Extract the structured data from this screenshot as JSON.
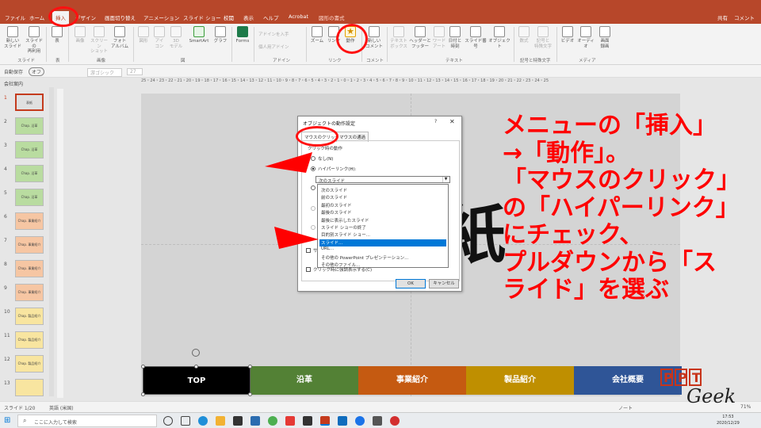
{
  "tabs": [
    {
      "label": "ファイル",
      "active": false
    },
    {
      "label": "ホーム",
      "active": false
    },
    {
      "label": "挿入",
      "active": true
    },
    {
      "label": "デザイン",
      "active": false
    },
    {
      "label": "画面切り替え",
      "active": false
    },
    {
      "label": "アニメーション",
      "active": false
    },
    {
      "label": "スライド ショー",
      "active": false
    },
    {
      "label": "校閲",
      "active": false
    },
    {
      "label": "表示",
      "active": false
    },
    {
      "label": "ヘルプ",
      "active": false
    },
    {
      "label": "Acrobat",
      "active": false
    },
    {
      "label": "図形の書式",
      "active": false
    }
  ],
  "titlebar": {
    "share": "共有",
    "comment": "コメント"
  },
  "ribbon": {
    "buttons": {
      "new_slide": "新しい\nスライド",
      "reuse_slide": "スライドの\n再利用",
      "table": "表",
      "image": "画像",
      "screenshot": "スクリーン\nショット",
      "photo_album": "フォト\nアルバム",
      "shapes": "図形",
      "icons": "アイ\nコン",
      "models_3d": "3D\nモデル",
      "smartart": "SmartArt",
      "chart": "グラフ",
      "forms": "Forms",
      "addins_get": "アドインを入手",
      "addins_personal": "個人用アドイン",
      "zoom": "ズーム",
      "link": "リンク",
      "action": "動作",
      "new_comment": "新しい\nコメント",
      "textbox": "テキスト\nボックス",
      "header_footer": "ヘッダーと\nフッター",
      "wordart": "ワード\nアート",
      "date_time": "日付と\n時刻",
      "slide_number": "スライド番号",
      "object": "オブジェクト",
      "equation": "数式",
      "symbol": "記号と\n特殊文字",
      "video": "ビデオ",
      "audio": "オーディオ",
      "screen_recording": "画面\n録画"
    },
    "groups": {
      "slides": "スライド",
      "table": "表",
      "images": "画像",
      "illustrations": "図",
      "addins": "アドイン",
      "links": "リンク",
      "comments": "コメント",
      "text": "テキスト",
      "symbols": "記号と特殊文字",
      "media": "メディア"
    }
  },
  "qat": {
    "autosave": "自動保存",
    "toggle": "オフ",
    "font": "游ゴシック",
    "size": "27"
  },
  "thumbnails": {
    "section": "会社案内",
    "slides": [
      {
        "num": "1",
        "label": "表紙",
        "color": "#e0e0e0",
        "border": "#c43b1d"
      },
      {
        "num": "2",
        "label": "Chap. 沿革",
        "color": "#b9dca0"
      },
      {
        "num": "3",
        "label": "Chap. 沿革",
        "color": "#b9dca0"
      },
      {
        "num": "4",
        "label": "Chap. 沿革",
        "color": "#b9dca0"
      },
      {
        "num": "5",
        "label": "Chap. 沿革",
        "color": "#b9dca0"
      },
      {
        "num": "6",
        "label": "Chap. 事業紹介",
        "color": "#f6c6a3"
      },
      {
        "num": "7",
        "label": "Chap. 事業紹介",
        "color": "#f6c6a3"
      },
      {
        "num": "8",
        "label": "Chap. 事業紹介",
        "color": "#f6c6a3"
      },
      {
        "num": "9",
        "label": "Chap. 事業紹介",
        "color": "#f6c6a3"
      },
      {
        "num": "10",
        "label": "Chap. 製品紹介",
        "color": "#f8e5a0"
      },
      {
        "num": "11",
        "label": "Chap. 製品紹介",
        "color": "#f8e5a0"
      },
      {
        "num": "12",
        "label": "Chap. 製品紹介",
        "color": "#f8e5a0"
      },
      {
        "num": "13",
        "label": "",
        "color": "#f8e5a0"
      }
    ]
  },
  "ruler": "25・24・23・22・21・20・19・18・17・16・15・14・13・12・11・10・9・8・7・6・5・4・3・2・1・0・1・2・3・4・5・6・7・8・9・10・11・12・13・14・15・16・17・18・19・20・21・22・23・24・25",
  "slide": {
    "big_char": "紙",
    "nav": [
      {
        "label": "TOP",
        "color": "#000000"
      },
      {
        "label": "沿革",
        "color": "#538135"
      },
      {
        "label": "事業紹介",
        "color": "#c55a11"
      },
      {
        "label": "製品紹介",
        "color": "#bf8f00"
      },
      {
        "label": "会社概要",
        "color": "#2f5597"
      }
    ]
  },
  "dialog": {
    "title": "オブジェクトの動作設定",
    "help": "?",
    "close": "✕",
    "tabs": [
      "マウスのクリック",
      "マウスの通過"
    ],
    "group_label": "クリック時の動作",
    "options": {
      "none": "なし(N)",
      "hyperlink": "ハイパーリンク(H):",
      "run_program": "",
      "run_macro": "",
      "object_action": ""
    },
    "combo_value": "次のスライド",
    "dropdown": [
      "次のスライド",
      "前のスライド",
      "最初のスライド",
      "最後のスライド",
      "最後に表示したスライド",
      "スライド ショーの終了",
      "目的別スライド ショー...",
      "スライド...",
      "URL...",
      "その他の PowerPoint プレゼンテーション...",
      "その他のファイル..."
    ],
    "selected_index": 7,
    "sound_label": "サ",
    "highlight_label": "クリック時に強調表示する(C)",
    "ok": "OK",
    "cancel": "キャンセル"
  },
  "annotation": {
    "lines": [
      "メニューの「挿入」",
      "→「動作」。",
      "「マウスのクリック」",
      "の「ハイパーリンク」",
      "にチェック、",
      "プルダウンから「ス",
      "ライド」を選ぶ"
    ],
    "color": "#ff0000"
  },
  "status": {
    "slide": "スライド 1/20",
    "lang": "英語 (米国)",
    "notes": "ノート",
    "zoom": "71%"
  },
  "taskbar": {
    "search_placeholder": "ここに入力して検索",
    "time": "17:53",
    "date": "2020/12/29"
  },
  "logo": {
    "text": "PPT Geek"
  }
}
